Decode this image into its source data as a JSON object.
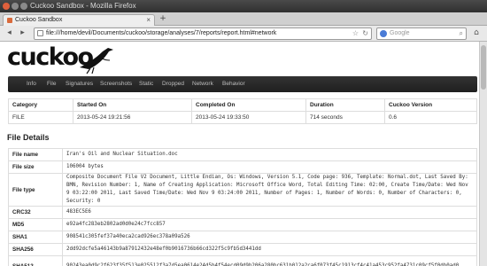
{
  "window": {
    "title": "Cuckoo Sandbox - Mozilla Firefox"
  },
  "browser": {
    "tab_label": "Cuckoo Sandbox",
    "tab_close": "×",
    "new_tab": "+",
    "url": "file:///home/devil/Documents/cuckoo/storage/analyses/7/reports/report.html#network",
    "search_placeholder": "Google",
    "back_icon": "◂",
    "forward_icon": "▸",
    "star_icon": "☆",
    "reload_icon": "↻",
    "search_icon": "⌕",
    "home_icon": "⌂"
  },
  "page": {
    "logo": "cuckoo",
    "menu": [
      "Info",
      "File",
      "Signatures",
      "Screenshots",
      "Static",
      "Dropped",
      "Network",
      "Behavior"
    ],
    "summary": {
      "headers": [
        "Category",
        "Started On",
        "Completed On",
        "Duration",
        "Cuckoo Version"
      ],
      "row": [
        "FILE",
        "2013-05-24 19:21:56",
        "2013-05-24 19:33:50",
        "714 seconds",
        "0.6"
      ]
    },
    "file_details_title": "File Details",
    "file_details": [
      {
        "key": "File name",
        "value": "Iran's Oil and Nuclear Situation.doc"
      },
      {
        "key": "File size",
        "value": "106004 bytes"
      },
      {
        "key": "File type",
        "value": "Composite Document File V2 Document, Little Endian, Os: Windows, Version 5.1, Code page: 936, Template: Normal.dot, Last Saved By: BMN, Revision Number: 1, Name of Creating Application: Microsoft Office Word, Total Editing Time: 02:00, Create Time/Date: Wed Nov 9 03:22:00 2011, Last Saved Time/Date: Wed Nov 9 03:24:00 2011, Number of Pages: 1, Number of Words: 0, Number of Characters: 0, Security: 0"
      },
      {
        "key": "CRC32",
        "value": "483EC5E6"
      },
      {
        "key": "MD5",
        "value": "e92a4fc283eb2802ad0d0e24c7fcc857"
      },
      {
        "key": "SHA1",
        "value": "908541c305fef37a40eca2cad926ec378a09a526"
      },
      {
        "key": "SHA256",
        "value": "2dd92dcfe5a46143b9a87912432e48ef0b9016736b66cd322f5c9fb5d3441dd"
      },
      {
        "key": "SHA512",
        "value": "90243ea0d9c2f623f35f513e025512f3a7d5ea0614e24d5b4f54ecd09d9b206a280bc631b012a2ca6f073f45c1913cf4c41a453c952fa4731c09cf5f0db0ad0"
      }
    ]
  }
}
